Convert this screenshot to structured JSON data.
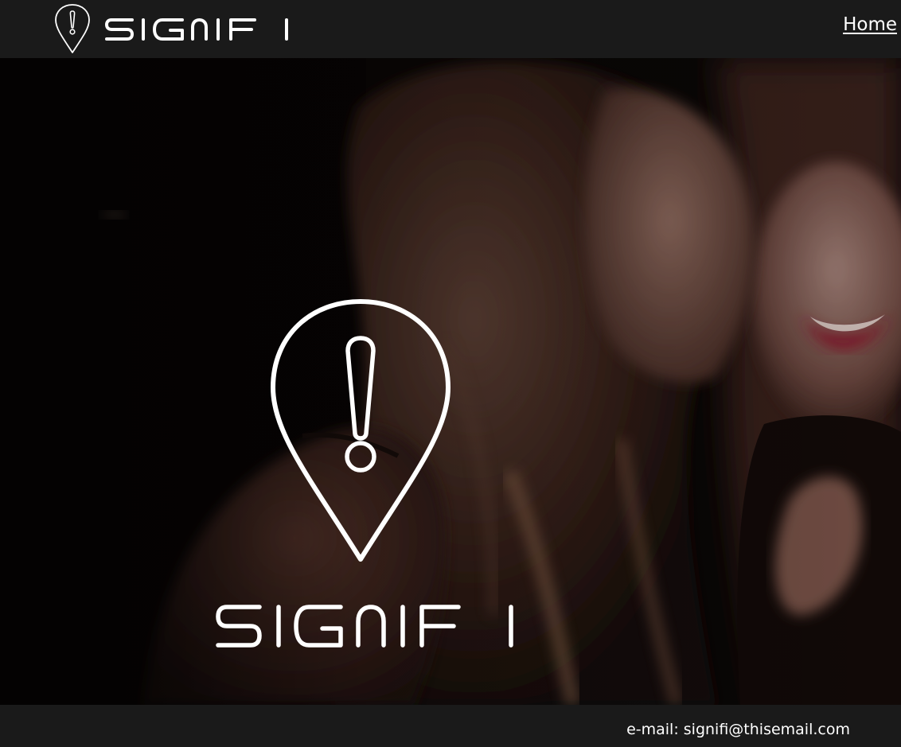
{
  "header": {
    "brand_name": "SIGNIFI",
    "nav": {
      "home_label": "Home"
    }
  },
  "hero": {
    "logo_name": "SIGNIFI",
    "logo_icon": "pin-exclamation-icon",
    "background_image": "two-women-laughing-photo"
  },
  "footer": {
    "contact_text": "e-mail: signifi@thisemail.com"
  },
  "colors": {
    "bar_background": "#1a1a1a",
    "text": "#ffffff",
    "hero_background": "#0b0706"
  }
}
